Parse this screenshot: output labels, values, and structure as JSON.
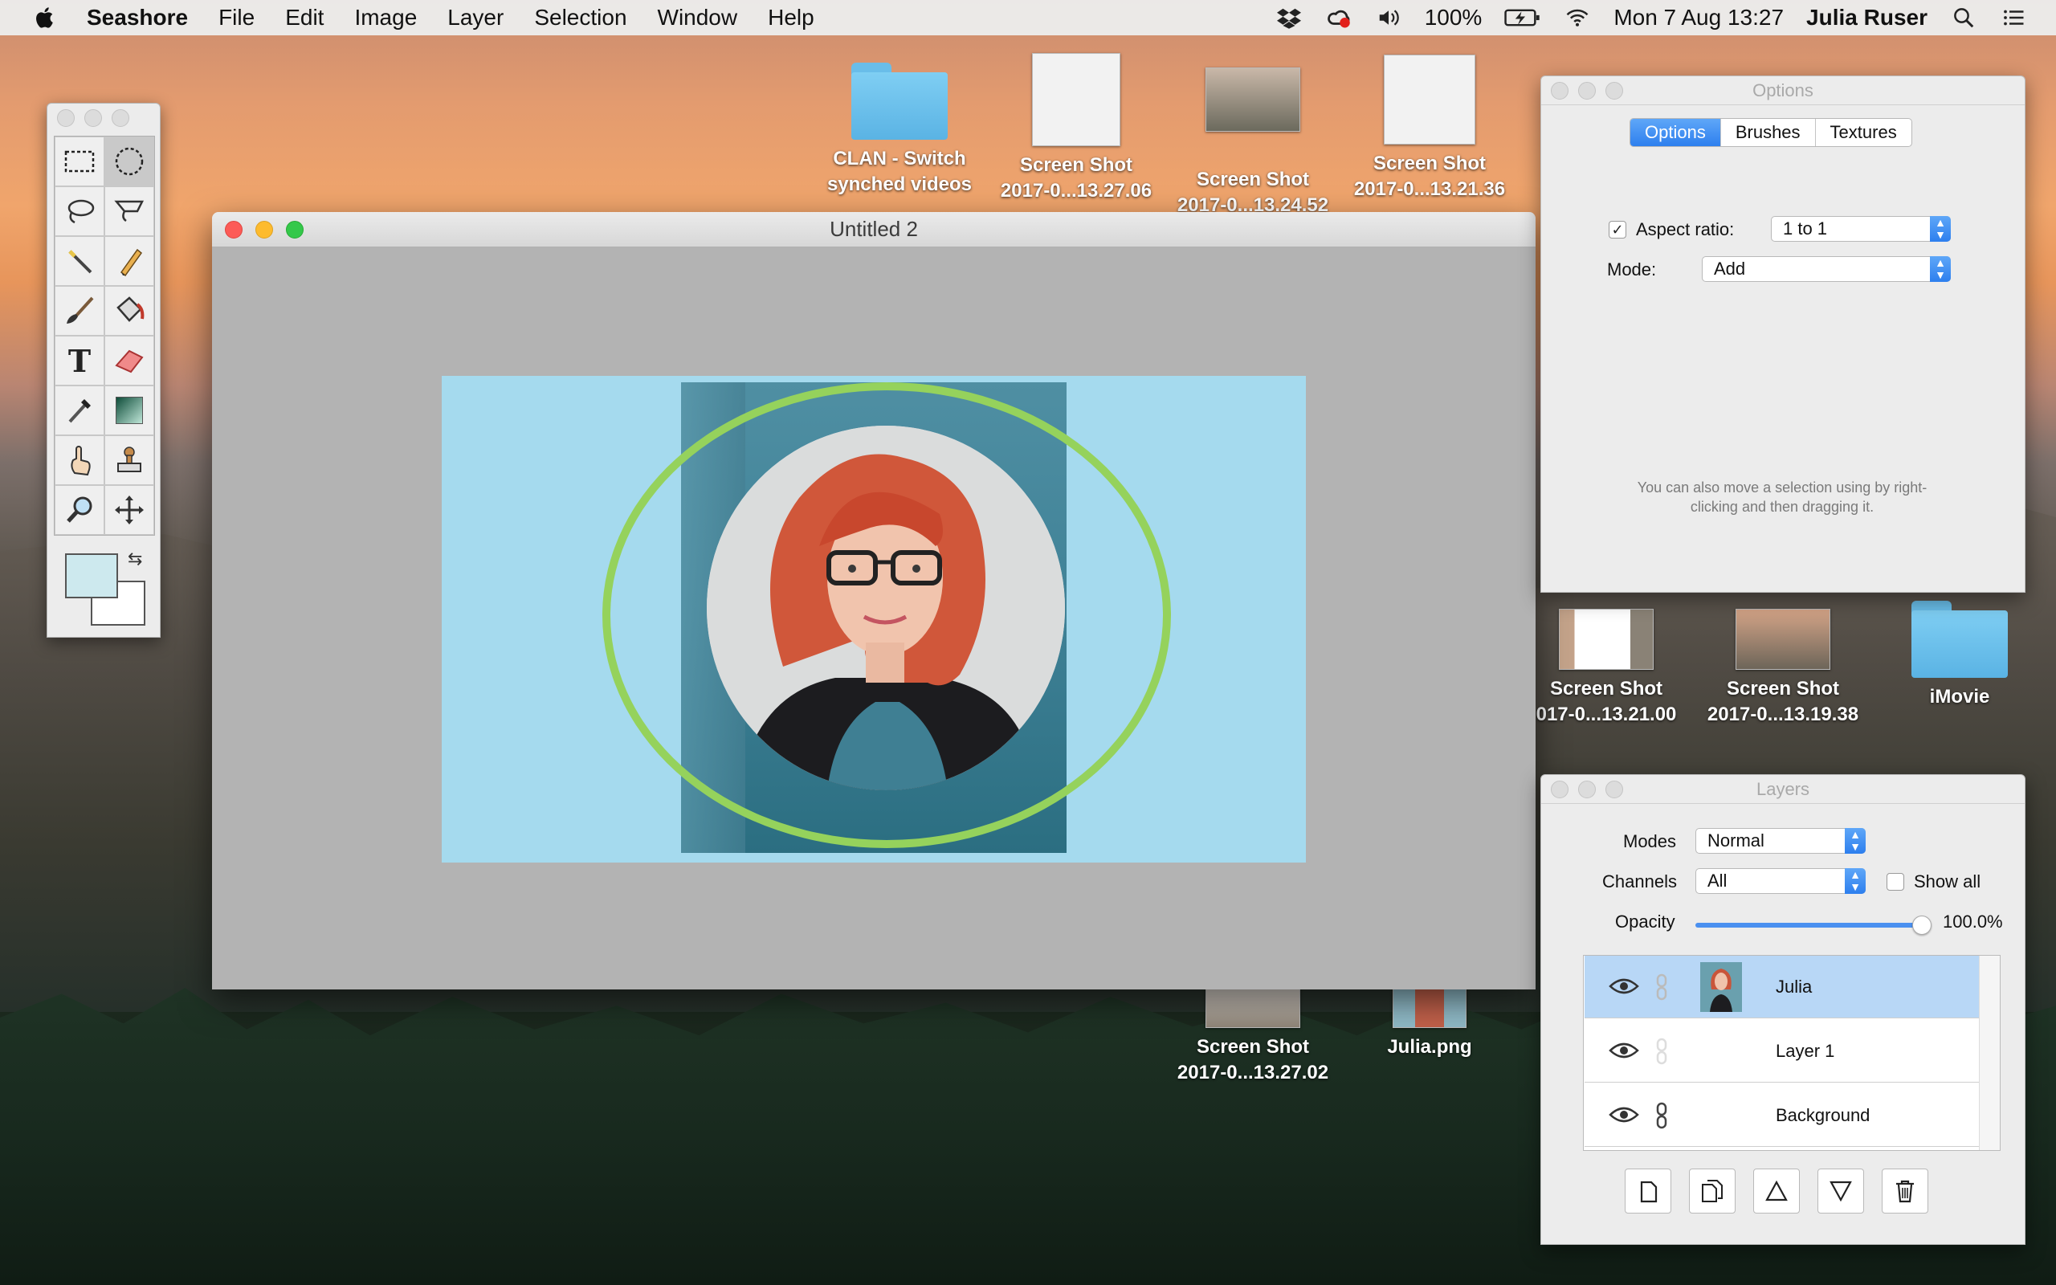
{
  "menubar": {
    "app_name": "Seashore",
    "menus": [
      "File",
      "Edit",
      "Image",
      "Layer",
      "Selection",
      "Window",
      "Help"
    ],
    "battery": "100%",
    "datetime": "Mon 7 Aug  13:27",
    "user": "Julia Ruser"
  },
  "desktop": {
    "icons": [
      {
        "line1": "CLAN - Switch",
        "line2": "synched videos"
      },
      {
        "line1": "Screen Shot",
        "line2": "2017-0...13.27.06"
      },
      {
        "line1": "Screen Shot",
        "line2": "2017-0...13.24.52"
      },
      {
        "line1": "Screen Shot",
        "line2": "2017-0...13.21.36"
      },
      {
        "line1": "Screen Shot",
        "line2": "017-0...13.21.00"
      },
      {
        "line1": "Screen Shot",
        "line2": "2017-0...13.19.38"
      },
      {
        "line1": "iMovie",
        "line2": ""
      },
      {
        "line1": "Screen Shot",
        "line2": "2017-0...13.27.02"
      },
      {
        "line1": "Julia.png",
        "line2": ""
      }
    ]
  },
  "tools": {
    "items": [
      "rect-select",
      "ellipse-select",
      "lasso",
      "polygon-lasso",
      "magic-wand",
      "pencil",
      "brush",
      "bucket-fill",
      "text",
      "eraser",
      "eyedropper",
      "gradient",
      "smudge",
      "clone-stamp",
      "zoom",
      "move"
    ],
    "foreground_color": "#cde9ee",
    "background_color": "#ffffff"
  },
  "document": {
    "title": "Untitled 2",
    "canvas_color": "#a5daee",
    "ring_color": "#95d25c"
  },
  "options_panel": {
    "title": "Options",
    "tabs": [
      "Options",
      "Brushes",
      "Textures"
    ],
    "active_tab": "Options",
    "aspect_ratio_label": "Aspect ratio:",
    "aspect_ratio_checked": true,
    "aspect_ratio_value": "1 to 1",
    "mode_label": "Mode:",
    "mode_value": "Add",
    "hint_line1": "You can also move a selection using by right-",
    "hint_line2": "clicking and then dragging it."
  },
  "layers_panel": {
    "title": "Layers",
    "modes_label": "Modes",
    "modes_value": "Normal",
    "channels_label": "Channels",
    "channels_value": "All",
    "show_all_label": "Show all",
    "opacity_label": "Opacity",
    "opacity_value": "100.0%",
    "opacity_fraction": 1.0,
    "layers": [
      {
        "name": "Julia",
        "selected": true
      },
      {
        "name": "Layer 1",
        "selected": false
      },
      {
        "name": "Background",
        "selected": false
      }
    ],
    "buttons": [
      "new-layer",
      "duplicate-layer",
      "raise-layer",
      "lower-layer",
      "delete-layer"
    ]
  }
}
